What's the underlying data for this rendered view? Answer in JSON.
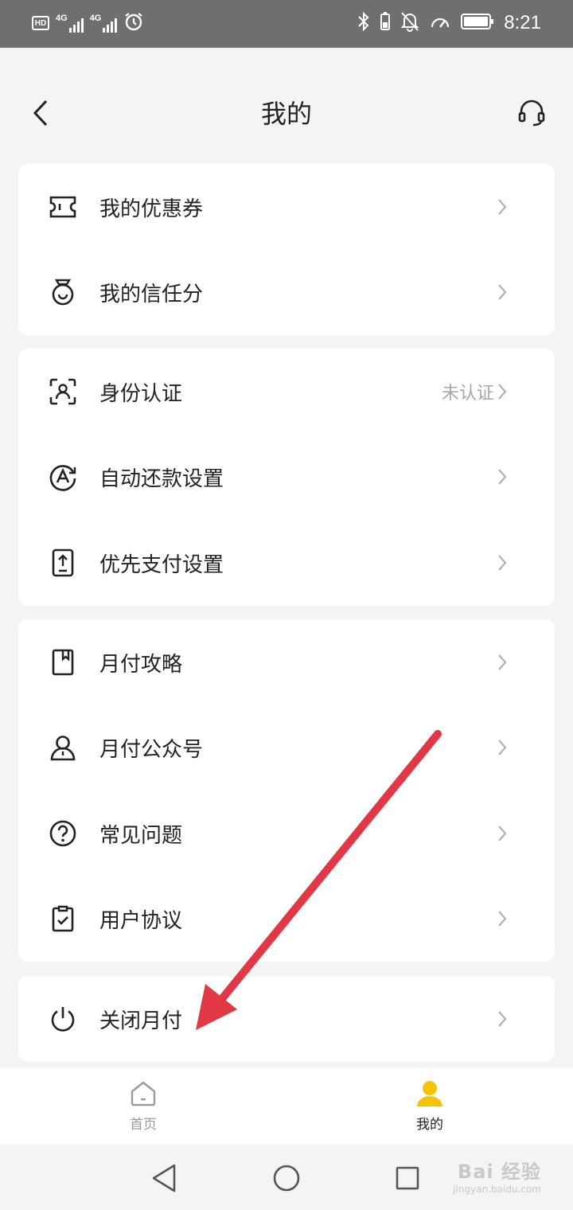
{
  "status_bar": {
    "hd": "HD",
    "sim1": "4G",
    "sim2": "4G",
    "time": "8:21"
  },
  "header": {
    "title": "我的"
  },
  "groups": [
    {
      "items": [
        {
          "label": "我的优惠券",
          "icon": "coupon-icon"
        },
        {
          "label": "我的信任分",
          "icon": "trust-score-icon"
        }
      ]
    },
    {
      "items": [
        {
          "label": "身份认证",
          "icon": "id-verify-icon",
          "extra": "未认证"
        },
        {
          "label": "自动还款设置",
          "icon": "auto-repay-icon"
        },
        {
          "label": "优先支付设置",
          "icon": "priority-pay-icon"
        }
      ]
    },
    {
      "items": [
        {
          "label": "月付攻略",
          "icon": "guide-book-icon"
        },
        {
          "label": "月付公众号",
          "icon": "person-icon"
        },
        {
          "label": "常见问题",
          "icon": "question-icon"
        },
        {
          "label": "用户协议",
          "icon": "agreement-icon"
        }
      ]
    },
    {
      "items": [
        {
          "label": "关闭月付",
          "icon": "power-icon"
        }
      ]
    }
  ],
  "tabbar": {
    "tabs": [
      {
        "label": "首页",
        "icon": "home-icon",
        "active": false
      },
      {
        "label": "我的",
        "icon": "user-icon",
        "active": true
      }
    ]
  },
  "colors": {
    "accent": "#f5c400",
    "arrow": "#e23744",
    "inactive_tab": "#9a9a9a"
  },
  "watermark": {
    "logo": "Bai 经验",
    "url": "jingyan.baidu.com"
  }
}
